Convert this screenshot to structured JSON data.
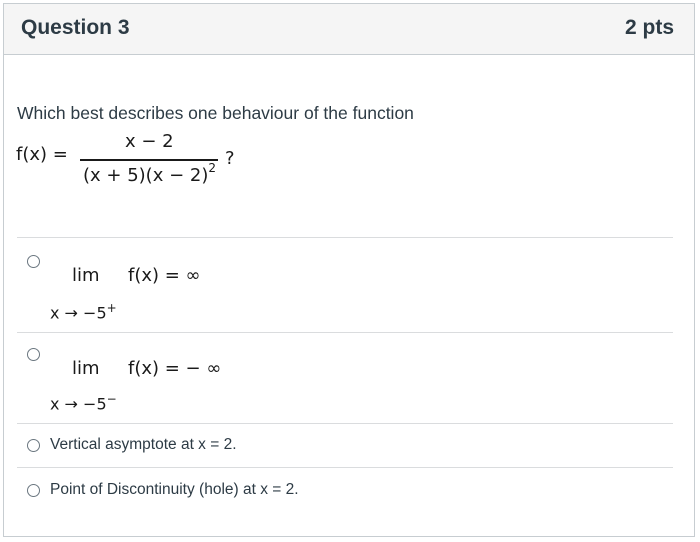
{
  "question": {
    "title": "Question 3",
    "points": "2 pts",
    "prompt": "Which best describes one behaviour of the function",
    "function_lhs": "f(x) =",
    "numerator": "x − 2",
    "denominator": "(x + 5)(x − 2)",
    "denominator_exp": "2",
    "question_mark": "?"
  },
  "options": [
    {
      "lim": "lim",
      "approach": "x → −5",
      "approach_sup": "+",
      "expr": "f(x) = ∞"
    },
    {
      "lim": "lim",
      "approach": "x → −5",
      "approach_sup": "−",
      "expr": "f(x) = − ∞"
    },
    {
      "text": "Vertical asymptote at x = 2."
    },
    {
      "text": "Point of Discontinuity (hole) at x = 2."
    }
  ]
}
